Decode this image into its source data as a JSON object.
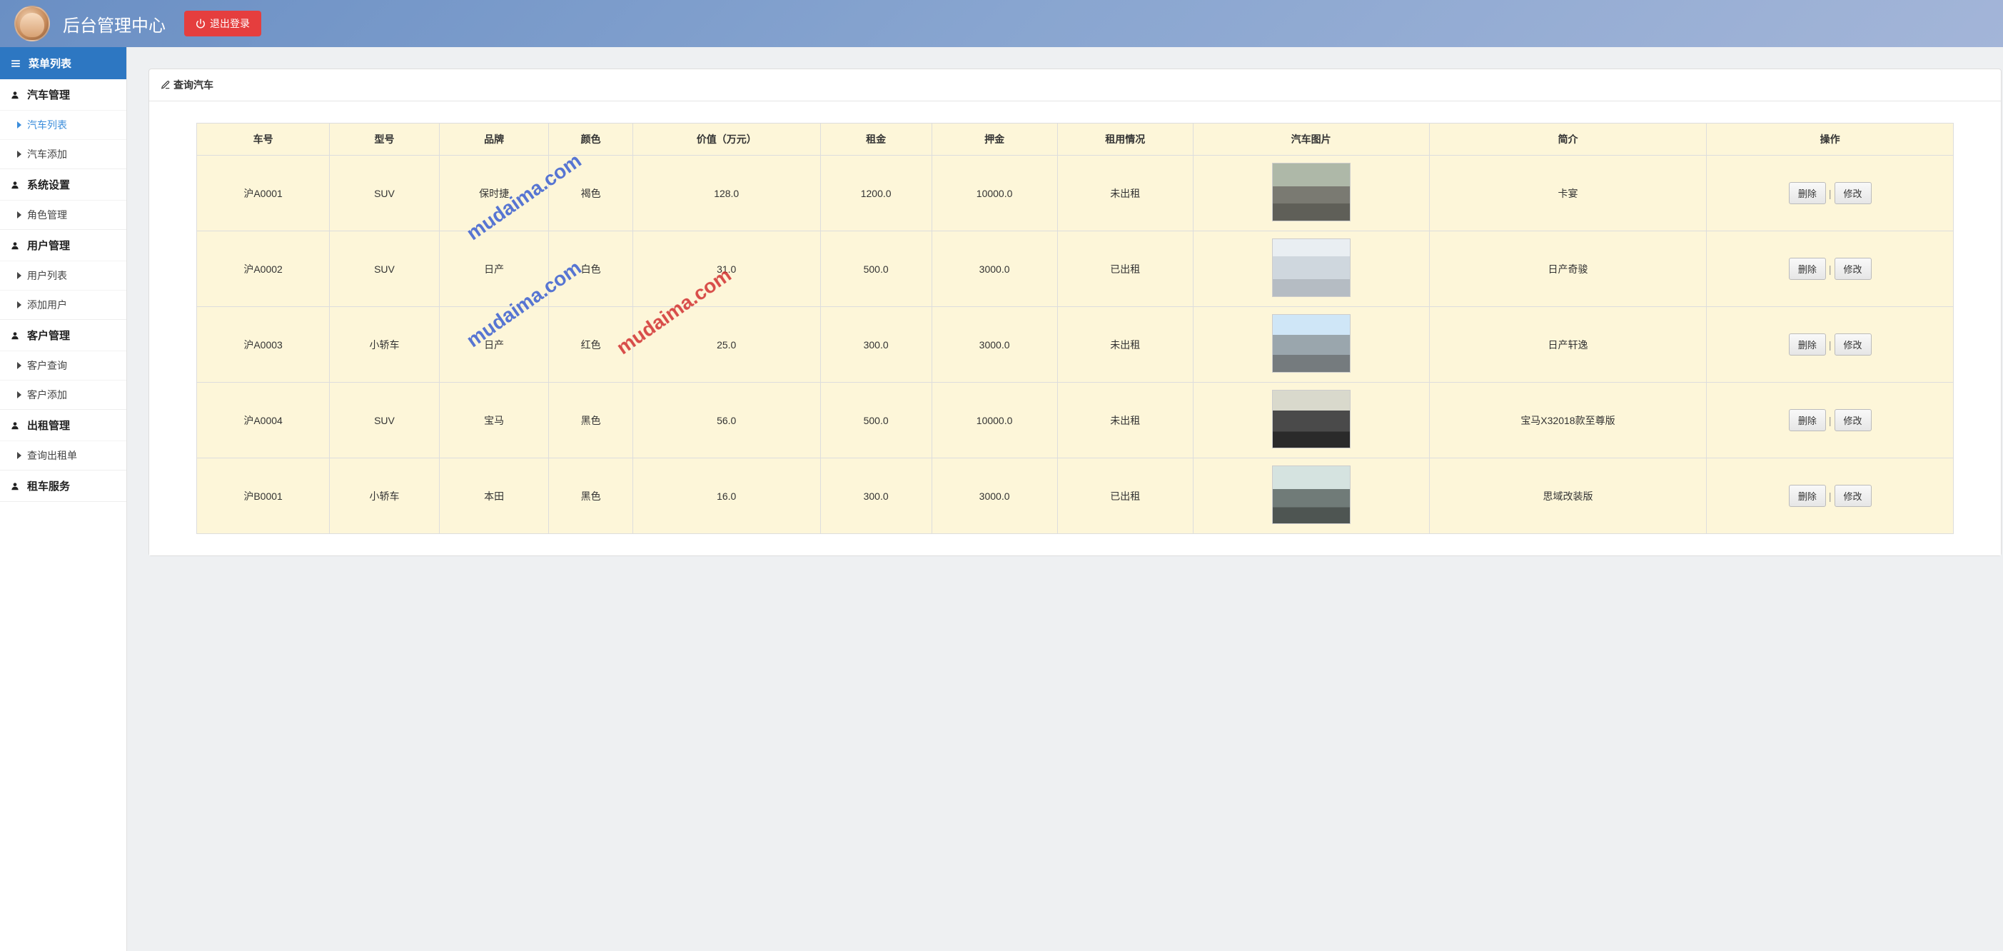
{
  "header": {
    "title": "后台管理中心",
    "logout_label": "退出登录"
  },
  "sidebar": {
    "menu_header": "菜单列表",
    "groups": [
      {
        "title": "汽车管理",
        "items": [
          {
            "label": "汽车列表",
            "active": true
          },
          {
            "label": "汽车添加",
            "active": false
          }
        ]
      },
      {
        "title": "系统设置",
        "items": [
          {
            "label": "角色管理",
            "active": false
          }
        ]
      },
      {
        "title": "用户管理",
        "items": [
          {
            "label": "用户列表",
            "active": false
          },
          {
            "label": "添加用户",
            "active": false
          }
        ]
      },
      {
        "title": "客户管理",
        "items": [
          {
            "label": "客户查询",
            "active": false
          },
          {
            "label": "客户添加",
            "active": false
          }
        ]
      },
      {
        "title": "出租管理",
        "items": [
          {
            "label": "查询出租单",
            "active": false
          }
        ]
      },
      {
        "title": "租车服务",
        "items": []
      }
    ]
  },
  "panel": {
    "title": "查询汽车"
  },
  "table": {
    "headers": [
      "车号",
      "型号",
      "品牌",
      "颜色",
      "价值（万元）",
      "租金",
      "押金",
      "租用情况",
      "汽车图片",
      "简介",
      "操作"
    ],
    "op_delete": "删除",
    "op_edit": "修改",
    "rows": [
      {
        "plate": "沪A0001",
        "model": "SUV",
        "brand": "保时捷",
        "color": "褐色",
        "value": "128.0",
        "rent": "1200.0",
        "deposit": "10000.0",
        "status": "未出租",
        "img": "c1",
        "desc": "卡宴"
      },
      {
        "plate": "沪A0002",
        "model": "SUV",
        "brand": "日产",
        "color": "白色",
        "value": "31.0",
        "rent": "500.0",
        "deposit": "3000.0",
        "status": "已出租",
        "img": "c2",
        "desc": "日产奇骏"
      },
      {
        "plate": "沪A0003",
        "model": "小轿车",
        "brand": "日产",
        "color": "红色",
        "value": "25.0",
        "rent": "300.0",
        "deposit": "3000.0",
        "status": "未出租",
        "img": "c3",
        "desc": "日产轩逸"
      },
      {
        "plate": "沪A0004",
        "model": "SUV",
        "brand": "宝马",
        "color": "黑色",
        "value": "56.0",
        "rent": "500.0",
        "deposit": "10000.0",
        "status": "未出租",
        "img": "c4",
        "desc": "宝马X32018款至尊版"
      },
      {
        "plate": "沪B0001",
        "model": "小轿车",
        "brand": "本田",
        "color": "黑色",
        "value": "16.0",
        "rent": "300.0",
        "deposit": "3000.0",
        "status": "已出租",
        "img": "c5",
        "desc": "思域改装版"
      }
    ]
  },
  "watermark": "mudaima.com"
}
